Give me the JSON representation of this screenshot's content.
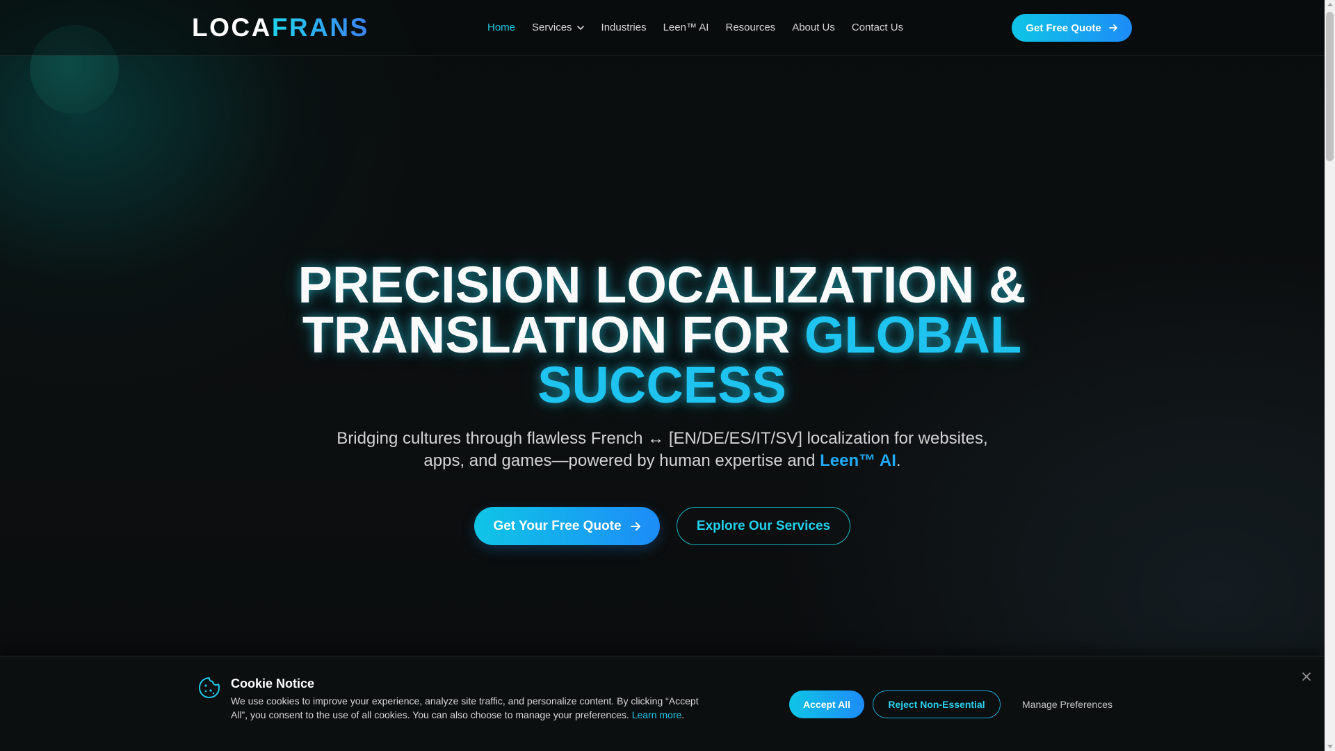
{
  "brand": {
    "logo_part1": "LOCA",
    "logo_part2": "FRANS"
  },
  "nav": {
    "items": [
      {
        "label": "Home",
        "active": true
      },
      {
        "label": "Services",
        "has_dropdown": true
      },
      {
        "label": "Industries"
      },
      {
        "label": "Leen™ AI"
      },
      {
        "label": "Resources"
      },
      {
        "label": "About Us"
      },
      {
        "label": "Contact Us"
      }
    ],
    "cta_label": "Get Free Quote"
  },
  "hero": {
    "title_line1": "PRECISION LOCALIZATION &",
    "title_line2_white": "TRANSLATION FOR ",
    "title_line2_highlight": "GLOBAL",
    "title_line3_highlight": "SUCCESS",
    "subtitle_main": "Bridging cultures through flawless French ↔ [EN/DE/ES/IT/SV] localization for websites, apps, and games—powered by human expertise and ",
    "subtitle_highlight": "Leen™ AI",
    "subtitle_end": ".",
    "primary_cta": "Get Your Free Quote",
    "secondary_cta": "Explore Our Services"
  },
  "cookie": {
    "title": "Cookie Notice",
    "text": "We use cookies to improve your experience, analyze site traffic, and personalize content. By clicking “Accept All”, you consent to the use of all cookies. You can also choose to manage your preferences. ",
    "learn_more": "Learn more",
    "text_end": ".",
    "accept_label": "Accept All",
    "reject_label": "Reject Non-Essential",
    "manage_label": "Manage Preferences"
  },
  "icons": {
    "nav_dropdown": "chevron-down-icon",
    "cta_arrow": "arrow-right-icon",
    "cookie": "cookie-icon",
    "close": "close-icon"
  },
  "colors": {
    "accent_cyan": "#22d3ee",
    "accent_blue": "#1d8cf8",
    "background": "#0a0d0d"
  }
}
